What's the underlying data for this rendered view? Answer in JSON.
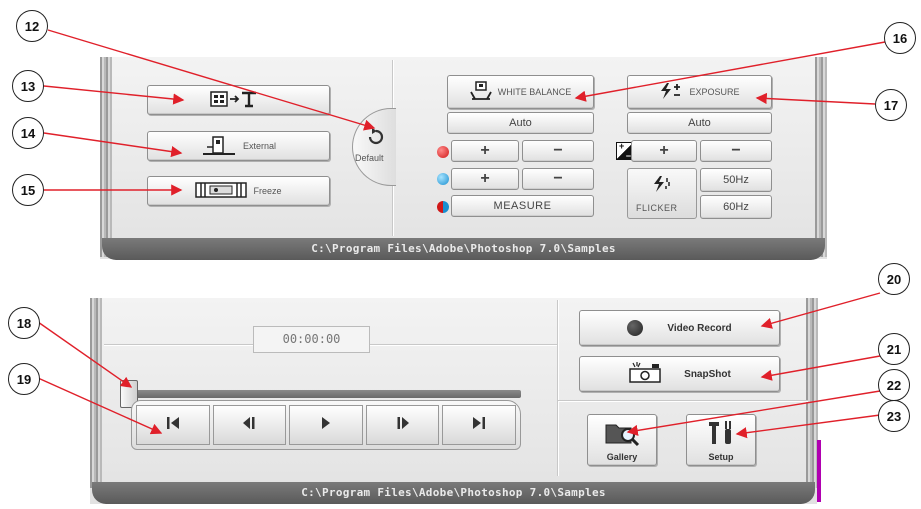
{
  "top_panel": {
    "text_button_icon": "snapshot-to-text-icon",
    "external_label": "External",
    "freeze_label": "Freeze",
    "default_label": "Default",
    "white_balance": {
      "label": "WHITE BALANCE",
      "mode": "Auto",
      "plus": "+",
      "minus": "−",
      "measure_label": "MEASURE",
      "red_color": "#e02a2a",
      "blue_color": "#2aa7e0"
    },
    "exposure": {
      "label": "EXPOSURE",
      "mode": "Auto",
      "plus": "+",
      "minus": "−",
      "flicker_label": "FLICKER",
      "hz50": "50Hz",
      "hz60": "60Hz"
    },
    "status_path": "C:\\Program Files\\Adobe\\Photoshop 7.0\\Samples"
  },
  "bottom_panel": {
    "timecode": "00:00:00",
    "video_record_label": "Video Record",
    "snapshot_label": "SnapShot",
    "gallery_label": "Gallery",
    "setup_label": "Setup",
    "status_path": "C:\\Program Files\\Adobe\\Photoshop 7.0\\Samples",
    "slider_position": 0
  },
  "callouts": {
    "c12": "12",
    "c13": "13",
    "c14": "14",
    "c15": "15",
    "c16": "16",
    "c17": "17",
    "c18": "18",
    "c19": "19",
    "c20": "20",
    "c21": "21",
    "c22": "22",
    "c23": "23"
  },
  "colors": {
    "arrow": "#e0202a",
    "status_bar": "#666666",
    "panel": "#ececec"
  }
}
